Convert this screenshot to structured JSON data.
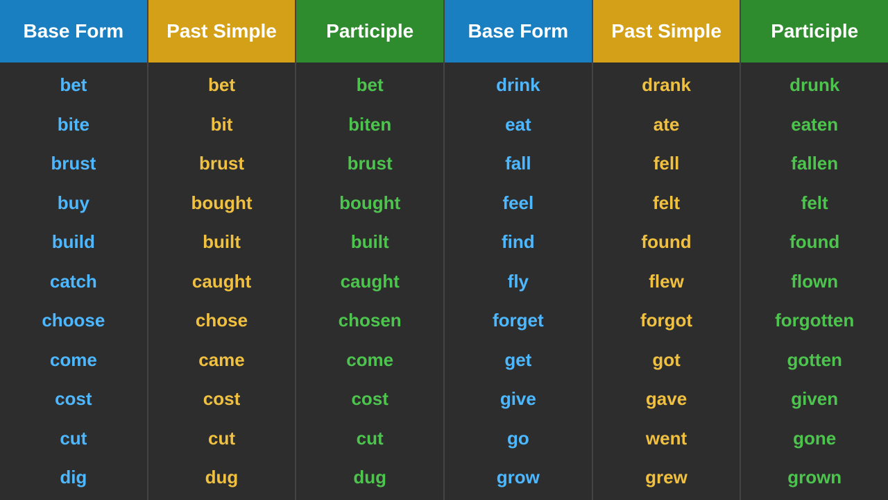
{
  "columns": [
    {
      "header": "Base Form",
      "headerClass": "blue-bg",
      "wordClass": "blue",
      "words": [
        "bet",
        "bite",
        "brust",
        "buy",
        "build",
        "catch",
        "choose",
        "come",
        "cost",
        "cut",
        "dig"
      ]
    },
    {
      "header": "Past Simple",
      "headerClass": "yellow-bg",
      "wordClass": "yellow",
      "words": [
        "bet",
        "bit",
        "brust",
        "bought",
        "built",
        "caught",
        "chose",
        "came",
        "cost",
        "cut",
        "dug"
      ]
    },
    {
      "header": "Participle",
      "headerClass": "green-bg",
      "wordClass": "green",
      "words": [
        "bet",
        "biten",
        "brust",
        "bought",
        "built",
        "caught",
        "chosen",
        "come",
        "cost",
        "cut",
        "dug"
      ]
    },
    {
      "header": "Base Form",
      "headerClass": "blue-bg",
      "wordClass": "blue",
      "words": [
        "drink",
        "eat",
        "fall",
        "feel",
        "find",
        "fly",
        "forget",
        "get",
        "give",
        "go",
        "grow"
      ]
    },
    {
      "header": "Past Simple",
      "headerClass": "yellow-bg",
      "wordClass": "yellow",
      "words": [
        "drank",
        "ate",
        "fell",
        "felt",
        "found",
        "flew",
        "forgot",
        "got",
        "gave",
        "went",
        "grew"
      ]
    },
    {
      "header": "Participle",
      "headerClass": "green-bg",
      "wordClass": "green",
      "words": [
        "drunk",
        "eaten",
        "fallen",
        "felt",
        "found",
        "flown",
        "forgotten",
        "gotten",
        "given",
        "gone",
        "grown"
      ]
    }
  ]
}
